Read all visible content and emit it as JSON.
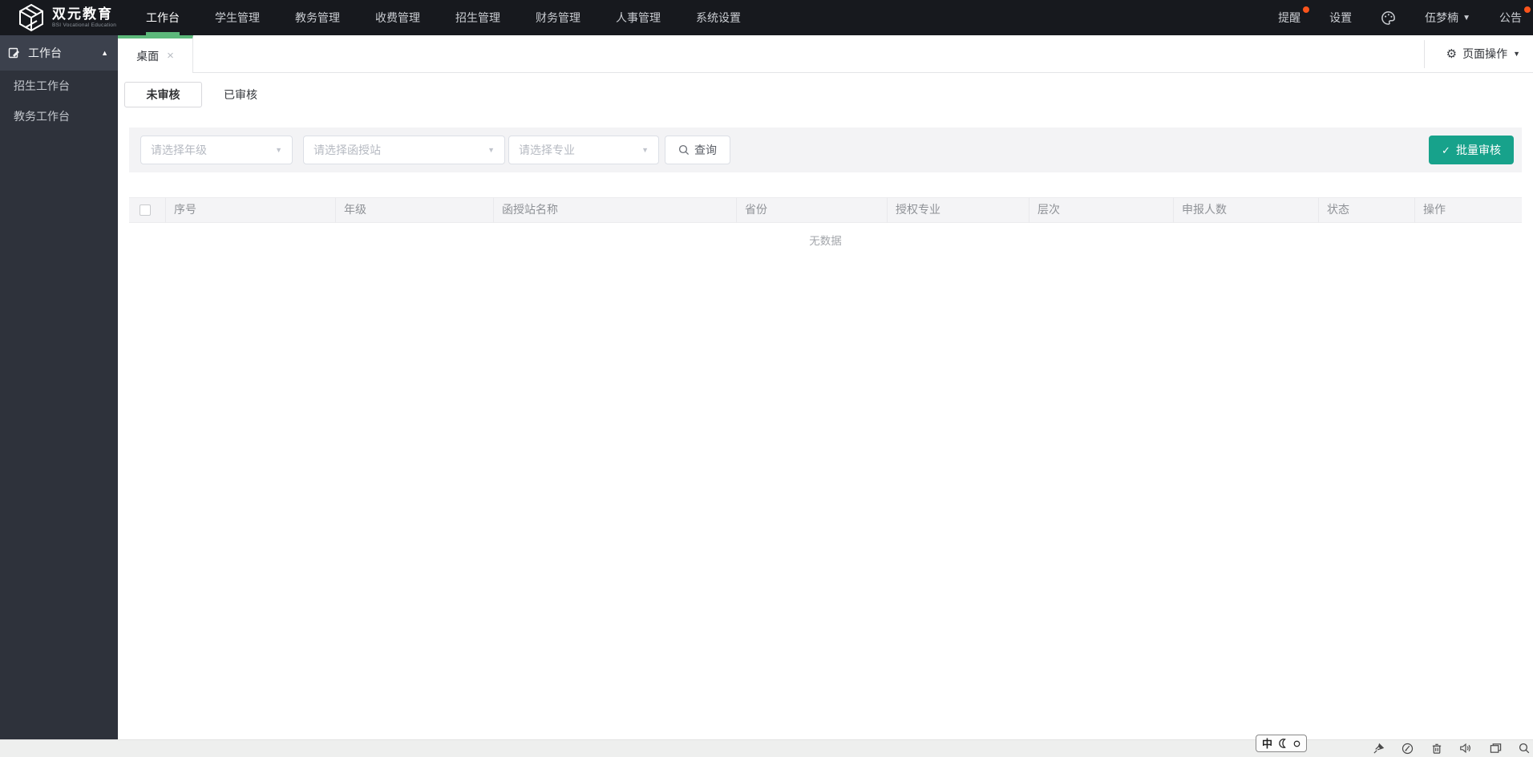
{
  "brand": {
    "name": "双元教育",
    "subtitle": "BSI Vocational Education"
  },
  "topnav": {
    "items": [
      {
        "label": "工作台",
        "active": true
      },
      {
        "label": "学生管理",
        "active": false
      },
      {
        "label": "教务管理",
        "active": false
      },
      {
        "label": "收费管理",
        "active": false
      },
      {
        "label": "招生管理",
        "active": false
      },
      {
        "label": "财务管理",
        "active": false
      },
      {
        "label": "人事管理",
        "active": false
      },
      {
        "label": "系统设置",
        "active": false
      }
    ],
    "reminder": "提醒",
    "settings": "设置",
    "user": "伍梦楠",
    "announcement": "公告"
  },
  "sidebar": {
    "header": "工作台",
    "items": [
      {
        "label": "招生工作台"
      },
      {
        "label": "教务工作台"
      }
    ]
  },
  "tabbar": {
    "active_tab": "桌面",
    "page_ops": "页面操作"
  },
  "subtabs": [
    {
      "label": "未审核",
      "active": true
    },
    {
      "label": "已审核",
      "active": false
    }
  ],
  "filters": {
    "grade_placeholder": "请选择年级",
    "station_placeholder": "请选择函授站",
    "major_placeholder": "请选择专业",
    "search_label": "查询",
    "batch_label": "批量审核"
  },
  "table": {
    "columns": [
      "序号",
      "年级",
      "函授站名称",
      "省份",
      "授权专业",
      "层次",
      "申报人数",
      "状态",
      "操作"
    ],
    "empty_text": "无数据",
    "rows": []
  },
  "ime": {
    "lang_indicator": "中"
  },
  "colors": {
    "nav_bg": "#17191e",
    "sidebar_bg": "#2e323b",
    "accent_green": "#5cb87a",
    "accent_teal": "#17a28b",
    "alert_orange": "#fa541c"
  }
}
